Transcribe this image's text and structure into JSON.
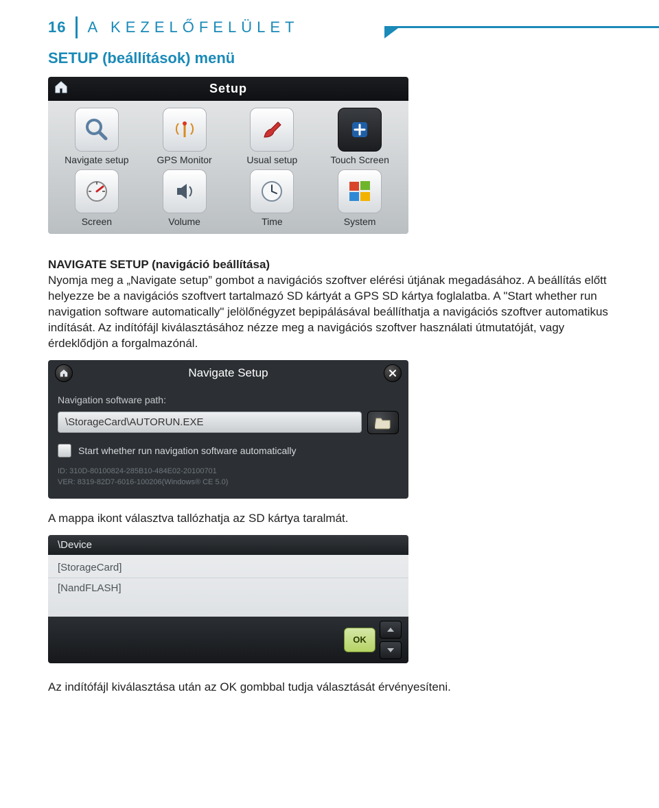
{
  "page_number": "16",
  "section_title": "A KEZELŐFELÜLET",
  "h2_setup": "SETUP (beállítások) menü",
  "setup_screenshot": {
    "title": "Setup",
    "items": [
      {
        "label": "Navigate setup",
        "icon": "magnifier-icon"
      },
      {
        "label": "GPS Monitor",
        "icon": "antenna-icon"
      },
      {
        "label": "Usual setup",
        "icon": "paintbrush-icon"
      },
      {
        "label": "Touch Screen",
        "icon": "plus-icon",
        "dark": true
      },
      {
        "label": "Screen",
        "icon": "gauge-icon"
      },
      {
        "label": "Volume",
        "icon": "speaker-icon"
      },
      {
        "label": "Time",
        "icon": "clock-icon"
      },
      {
        "label": "System",
        "icon": "windows-icon"
      }
    ]
  },
  "h3_navigate": "NAVIGATE SETUP (navigáció beállítása)",
  "para1": "Nyomja meg a „Navigate setup” gombot a navigációs szoftver elérési útjának megadásához. A beállítás előtt helyezze be a navigációs szoftvert tartalmazó SD kártyát a GPS SD kártya foglalatba. A \"Start whether run navigation software automatically\" jelölőnégyzet bepipálásával beállíthatja a navigációs szoftver automatikus indítását. Az indítófájl kiválasztásához nézze meg a navigációs szoftver használati útmutatóját, vagy érdeklődjön a forgalmazónál.",
  "nav_screenshot": {
    "title": "Navigate Setup",
    "path_label": "Navigation software path:",
    "path_value": "\\StorageCard\\AUTORUN.EXE",
    "checkbox_label": "Start whether run navigation software automatically",
    "id_line": "ID: 310D-80100824-285B10-484E02-20100701",
    "ver_line": "VER: 8319-82D7-6016-100206(Windows® CE 5.0)"
  },
  "para2": "A mappa ikont választva tallózhatja az SD kártya taralmát.",
  "dev_screenshot": {
    "path": "\\Device",
    "items": [
      "[StorageCard]",
      "[NandFLASH]"
    ],
    "ok": "OK"
  },
  "para3": "Az indítófájl kiválasztása után az OK gombbal tudja választását érvényesíteni."
}
